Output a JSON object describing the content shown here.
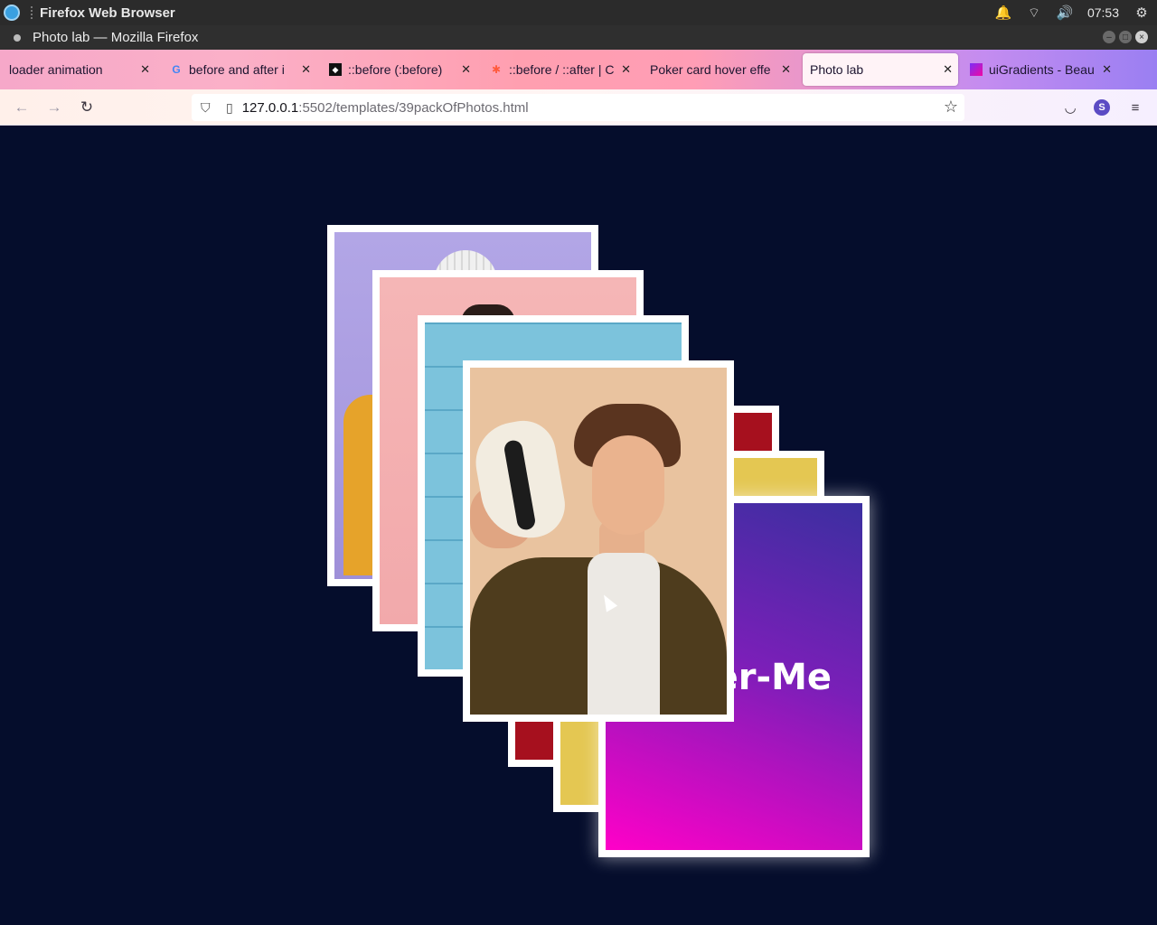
{
  "os": {
    "app_title": "Firefox Web Browser",
    "time": "07:53"
  },
  "window": {
    "title": "Photo lab — Mozilla Firefox"
  },
  "tabs": [
    {
      "label": "loader animation"
    },
    {
      "label": "before and after i"
    },
    {
      "label": "::before (:before)"
    },
    {
      "label": "::before / ::after | C"
    },
    {
      "label": "Poker card hover effe"
    },
    {
      "label": "Photo lab"
    },
    {
      "label": "uiGradients - Beau"
    }
  ],
  "navbar": {
    "url_host": "127.0.0.1",
    "url_path": ":5502/templates/39packOfPhotos.html",
    "account_initial": "S"
  },
  "page": {
    "hover_card_text": "Hover-Me"
  },
  "icons": {
    "back": "back-arrow-icon",
    "forward": "forward-arrow-icon",
    "reload": "reload-icon",
    "shield": "shield-icon",
    "page": "page-icon",
    "star": "bookmark-star-icon",
    "pocket": "pocket-icon",
    "menu": "hamburger-menu-icon"
  },
  "colors": {
    "page_background": "#050d2c",
    "card_gradient_top": "#3b2fa0",
    "card_gradient_bottom": "#ff00c8"
  }
}
